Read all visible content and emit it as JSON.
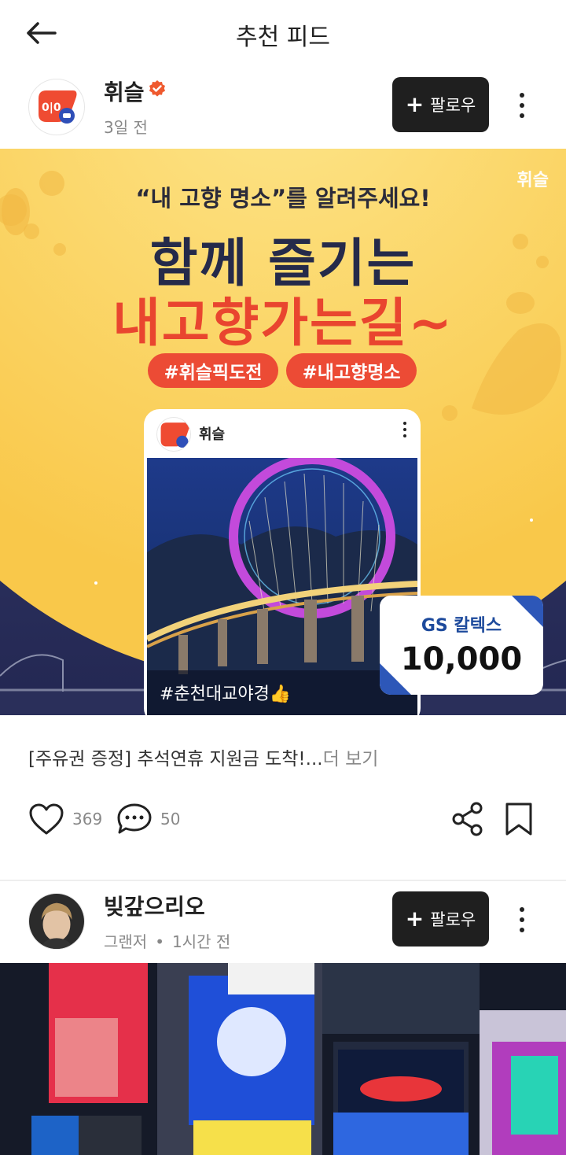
{
  "header": {
    "title": "추천 피드"
  },
  "posts": [
    {
      "author": "휘슬",
      "verified": true,
      "meta": "3일 전",
      "follow_label": "팔로우",
      "banner": {
        "brand": "휘슬",
        "question": "“내 고향 명소”를 알려주세요!",
        "headline_1": "함께 즐기는",
        "headline_2": "내고향가는길~",
        "tags": [
          "#휘슬픽도전",
          "#내고향명소"
        ],
        "card_author": "휘슬",
        "card_caption": "#춘천대교야경👍",
        "coupon_brand": "GS 칼텍스",
        "coupon_amount": "10,000"
      },
      "text": "[주유권 증정] 추석연휴 지원금 도착!...",
      "more_label": "더 보기",
      "likes": "369",
      "comments": "50"
    },
    {
      "author": "빚갚으리오",
      "meta_prefix": "그랜저",
      "meta_time": "1시간 전",
      "follow_label": "팔로우"
    }
  ],
  "icons": {
    "back": "arrow-left-icon",
    "verified": "verified-badge-icon",
    "like": "heart-icon",
    "comment": "speech-bubble-icon",
    "share": "share-icon",
    "bookmark": "bookmark-icon",
    "more": "vertical-dots-icon"
  },
  "colors": {
    "accent": "#ec4b35",
    "follow_bg": "#1f1f1f",
    "banner_yellow": "#fcd860",
    "banner_navy": "#2a2f5a"
  }
}
